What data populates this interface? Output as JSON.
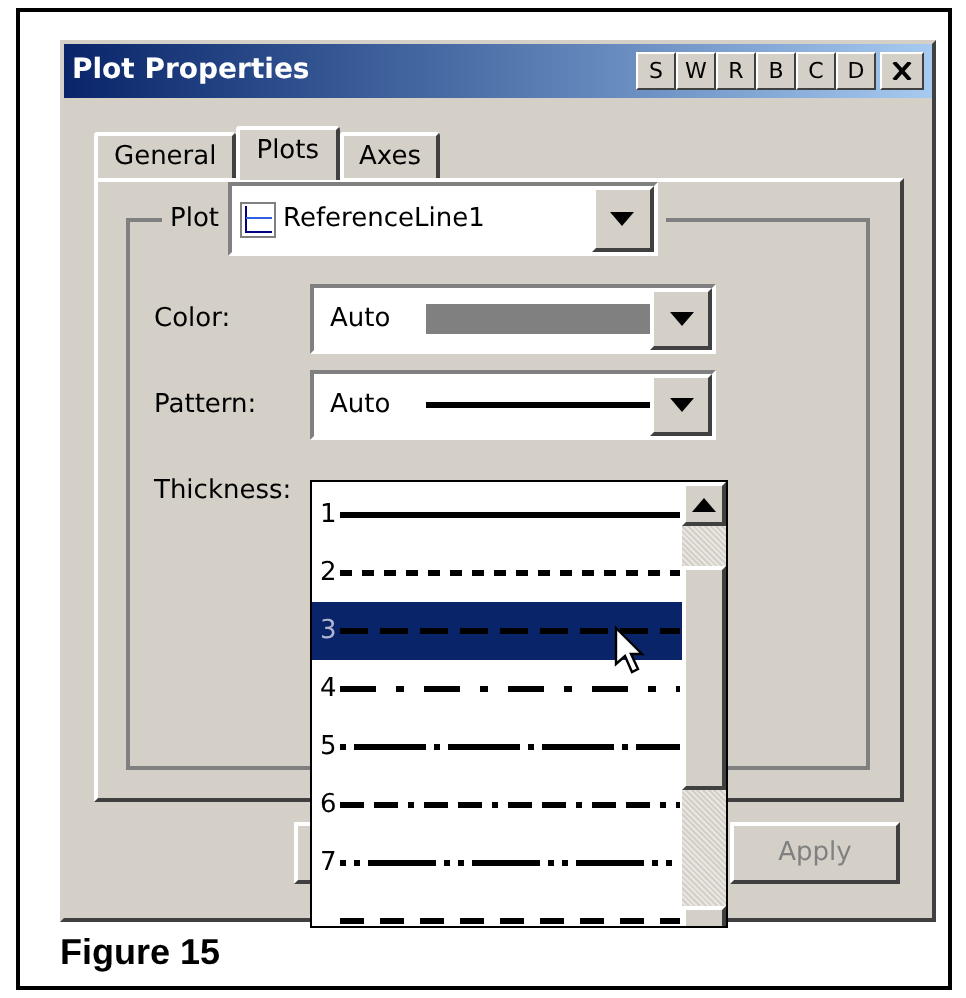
{
  "window": {
    "title": "Plot Properties",
    "title_buttons": [
      "S",
      "W",
      "R",
      "B",
      "C",
      "D"
    ]
  },
  "tabs": [
    {
      "label": "General",
      "selected": false
    },
    {
      "label": "Plots",
      "selected": true
    },
    {
      "label": "Axes",
      "selected": false
    }
  ],
  "plot_group": {
    "label": "Plot",
    "value": "ReferenceLine1"
  },
  "fields": [
    {
      "label": "Color:",
      "value": "Auto",
      "kind": "color"
    },
    {
      "label": "Pattern:",
      "value": "Auto",
      "kind": "pattern"
    },
    {
      "label": "Thickness:",
      "kind": "hidden"
    }
  ],
  "pattern_list": [
    {
      "label": "1",
      "kind": "solid",
      "selected": false
    },
    {
      "label": "2",
      "kind": "short-dash",
      "selected": false
    },
    {
      "label": "3",
      "kind": "long-dash",
      "selected": true
    },
    {
      "label": "4",
      "kind": "dash-dot",
      "selected": false
    },
    {
      "label": "5",
      "kind": "dot-long-dash",
      "selected": false
    },
    {
      "label": "6",
      "kind": "dash-dash-dot",
      "selected": false
    },
    {
      "label": "7",
      "kind": "dot-dot-long",
      "selected": false
    },
    {
      "kind": "dash",
      "selected": false
    }
  ],
  "buttons": [
    {
      "label": "Apply",
      "disabled": true
    }
  ],
  "caption": "Figure 15"
}
